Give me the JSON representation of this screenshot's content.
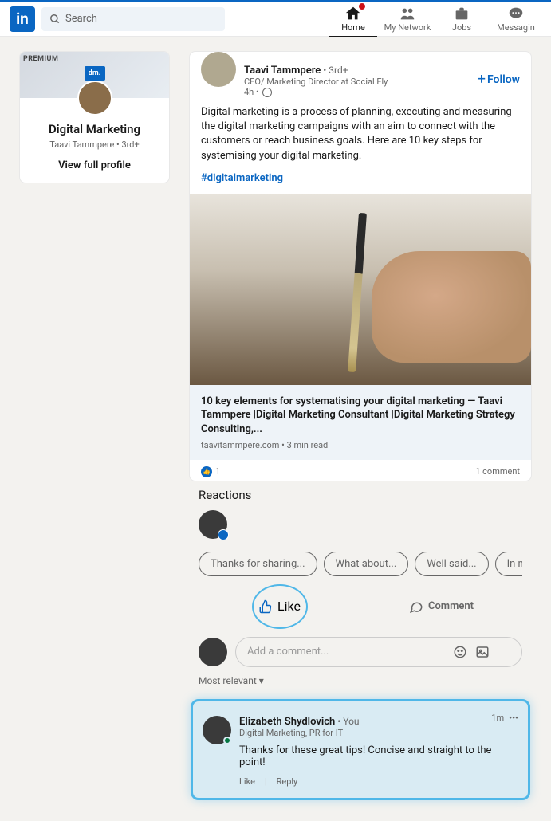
{
  "nav": {
    "search_placeholder": "Search",
    "items": {
      "home": "Home",
      "network": "My Network",
      "jobs": "Jobs",
      "messaging": "Messagin"
    }
  },
  "sidebar": {
    "premium": "PREMIUM",
    "logo_text": "dm.",
    "name": "Digital Marketing",
    "subtitle": "Taavi Tammpere • 3rd+",
    "link": "View full profile"
  },
  "post": {
    "author": "Taavi Tammpere",
    "connection": " • 3rd+",
    "title": "CEO/ Marketing Director at Social Fly",
    "time": "4h • ",
    "follow": "Follow",
    "body": "Digital marketing is a process of planning, executing and measuring the digital marketing campaigns with an aim to connect with the customers or reach business goals. Here are 10 key steps for systemising your digital marketing.",
    "hashtag": "#digitalmarketing",
    "article_title": "10 key elements for systematising your digital marketing — Taavi Tammpere |Digital Marketing Consultant |Digital Marketing Strategy Consulting,...",
    "article_source": "taavitammpere.com • 3 min read",
    "like_count": "1",
    "comment_count": "1 comment"
  },
  "reactions": {
    "title": "Reactions",
    "suggestions": [
      "Thanks for sharing...",
      "What about...",
      "Well said...",
      "In my opinio..."
    ]
  },
  "actions": {
    "like": "Like",
    "comment": "Comment"
  },
  "composer": {
    "placeholder": "Add a comment...",
    "sort": "Most relevant ▾"
  },
  "comment": {
    "name": "Elizabeth Shydlovich",
    "you": " • You",
    "title": "Digital Marketing, PR for IT",
    "time": "1m",
    "text": "Thanks for these great tips! Concise and straight to the point!",
    "like": "Like",
    "reply": "Reply"
  }
}
